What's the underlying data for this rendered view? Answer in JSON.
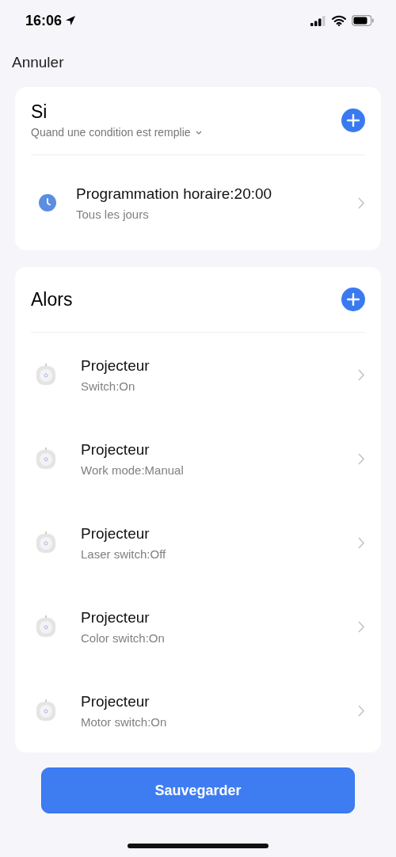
{
  "status_bar": {
    "time": "16:06"
  },
  "nav": {
    "cancel": "Annuler"
  },
  "condition_card": {
    "title": "Si",
    "mode": "Quand une condition est remplie",
    "items": [
      {
        "kind": "schedule",
        "title": "Programmation horaire:20:00",
        "subtitle": "Tous les jours"
      }
    ]
  },
  "action_card": {
    "title": "Alors",
    "items": [
      {
        "kind": "device",
        "title": "Projecteur",
        "subtitle": "Switch:On"
      },
      {
        "kind": "device",
        "title": "Projecteur",
        "subtitle": "Work mode:Manual"
      },
      {
        "kind": "device",
        "title": "Projecteur",
        "subtitle": "Laser switch:Off"
      },
      {
        "kind": "device",
        "title": "Projecteur",
        "subtitle": "Color switch:On"
      },
      {
        "kind": "device",
        "title": "Projecteur",
        "subtitle": "Motor switch:On"
      }
    ]
  },
  "save_button": "Sauvegarder"
}
